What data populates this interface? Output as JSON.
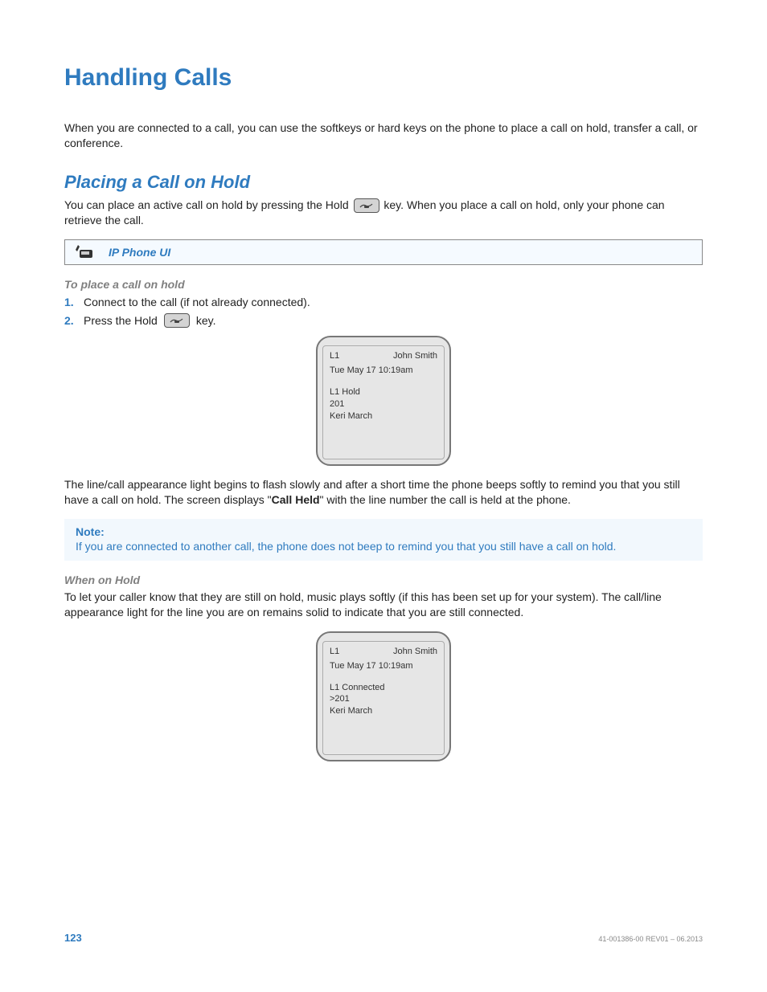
{
  "title": "Handling Calls",
  "intro": "When you are connected to a call, you can use the softkeys or hard keys on the phone to place a call on hold, transfer a call, or conference.",
  "section1": {
    "heading": "Placing a Call on Hold",
    "body_pre": "You can place an active call on hold by pressing the Hold ",
    "body_post": " key. When you place a call on hold, only your phone can retrieve the call.",
    "ui_bar_label": "IP Phone UI",
    "sub_heading": "To place a call on hold",
    "steps": [
      {
        "num": "1.",
        "text": "Connect to the call (if not already connected)."
      },
      {
        "num": "2.",
        "pre": "Press the Hold ",
        "post": " key."
      }
    ],
    "phone1": {
      "line": "L1",
      "name": "John Smith",
      "datetime": "Tue May 17 10:19am",
      "status": "L1 Hold",
      "ext": "201",
      "caller": "Keri March"
    },
    "after_phone_pre": "The line/call appearance light begins to flash slowly and after a short time the phone beeps softly to remind you that you still have a call on hold. The screen displays \"",
    "after_phone_bold": "Call Held",
    "after_phone_post": "\" with the line number the call is held at the phone.",
    "note_label": "Note:",
    "note_text": "If you are connected to another call, the phone does not beep to remind you that you still have a call on hold."
  },
  "section2": {
    "heading": "When on Hold",
    "body": "To let your caller know that they are still on hold, music plays softly (if this has been set up for your system). The call/line appearance light for the line you are on remains solid to indicate that you are still connected.",
    "phone2": {
      "line": "L1",
      "name": "John Smith",
      "datetime": "Tue May 17 10:19am",
      "status": "L1 Connected",
      "ext": ">201",
      "caller": "Keri March"
    }
  },
  "footer": {
    "page": "123",
    "rev": "41-001386-00 REV01  – 06.2013"
  }
}
